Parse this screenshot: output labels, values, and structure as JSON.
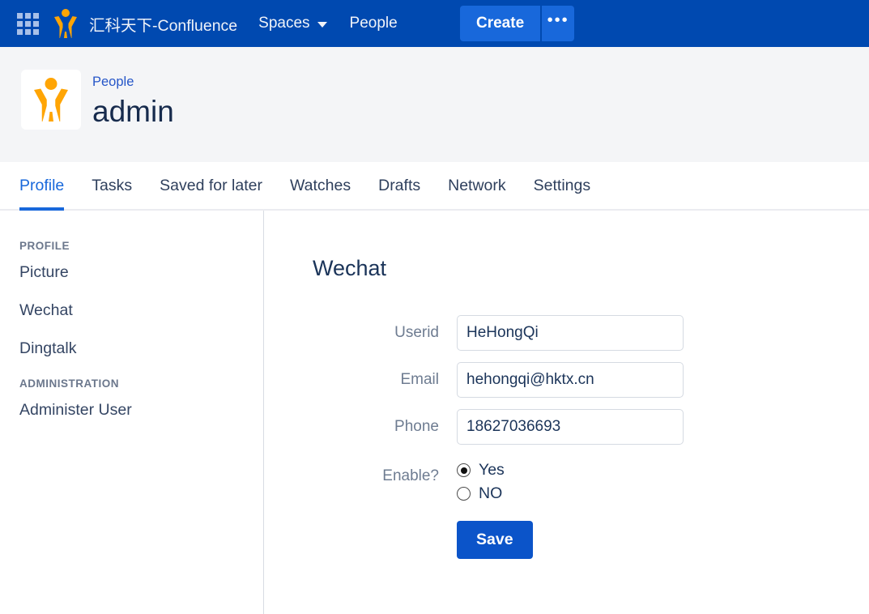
{
  "topnav": {
    "app_switcher_icon": "grid-apps-icon",
    "logo_icon": "confluence-person-logo",
    "site_name": "汇科天下-Confluence",
    "spaces_label": "Spaces",
    "spaces_chevron_icon": "chevron-down-icon",
    "people_label": "People",
    "create_label": "Create",
    "more_label": "•••",
    "bg_color": "#0049B0",
    "button_color": "#1868DB"
  },
  "pageheader": {
    "avatar_icon": "user-avatar-person-logo",
    "breadcrumb": "People",
    "title": "admin",
    "bg_color": "#F4F5F7"
  },
  "tabs": [
    {
      "label": "Profile",
      "active": true
    },
    {
      "label": "Tasks",
      "active": false
    },
    {
      "label": "Saved for later",
      "active": false
    },
    {
      "label": "Watches",
      "active": false
    },
    {
      "label": "Drafts",
      "active": false
    },
    {
      "label": "Network",
      "active": false
    },
    {
      "label": "Settings",
      "active": false
    }
  ],
  "sidebar": {
    "profile_heading": "PROFILE",
    "profile_items": [
      {
        "label": "Picture"
      },
      {
        "label": "Wechat"
      },
      {
        "label": "Dingtalk"
      }
    ],
    "administration_heading": "ADMINISTRATION",
    "administration_items": [
      {
        "label": "Administer User"
      }
    ]
  },
  "form": {
    "title": "Wechat",
    "fields": [
      {
        "label": "Userid",
        "value": "HeHongQi",
        "placeholder": ""
      },
      {
        "label": "Email",
        "value": "hehongqi@hktx.cn",
        "placeholder": ""
      },
      {
        "label": "Phone",
        "value": "18627036693",
        "placeholder": ""
      }
    ],
    "enable_label": "Enable?",
    "radio_yes": "Yes",
    "radio_no": "NO",
    "radio_selected": "Yes",
    "save_label": "Save",
    "save_color": "#0B54C9"
  }
}
